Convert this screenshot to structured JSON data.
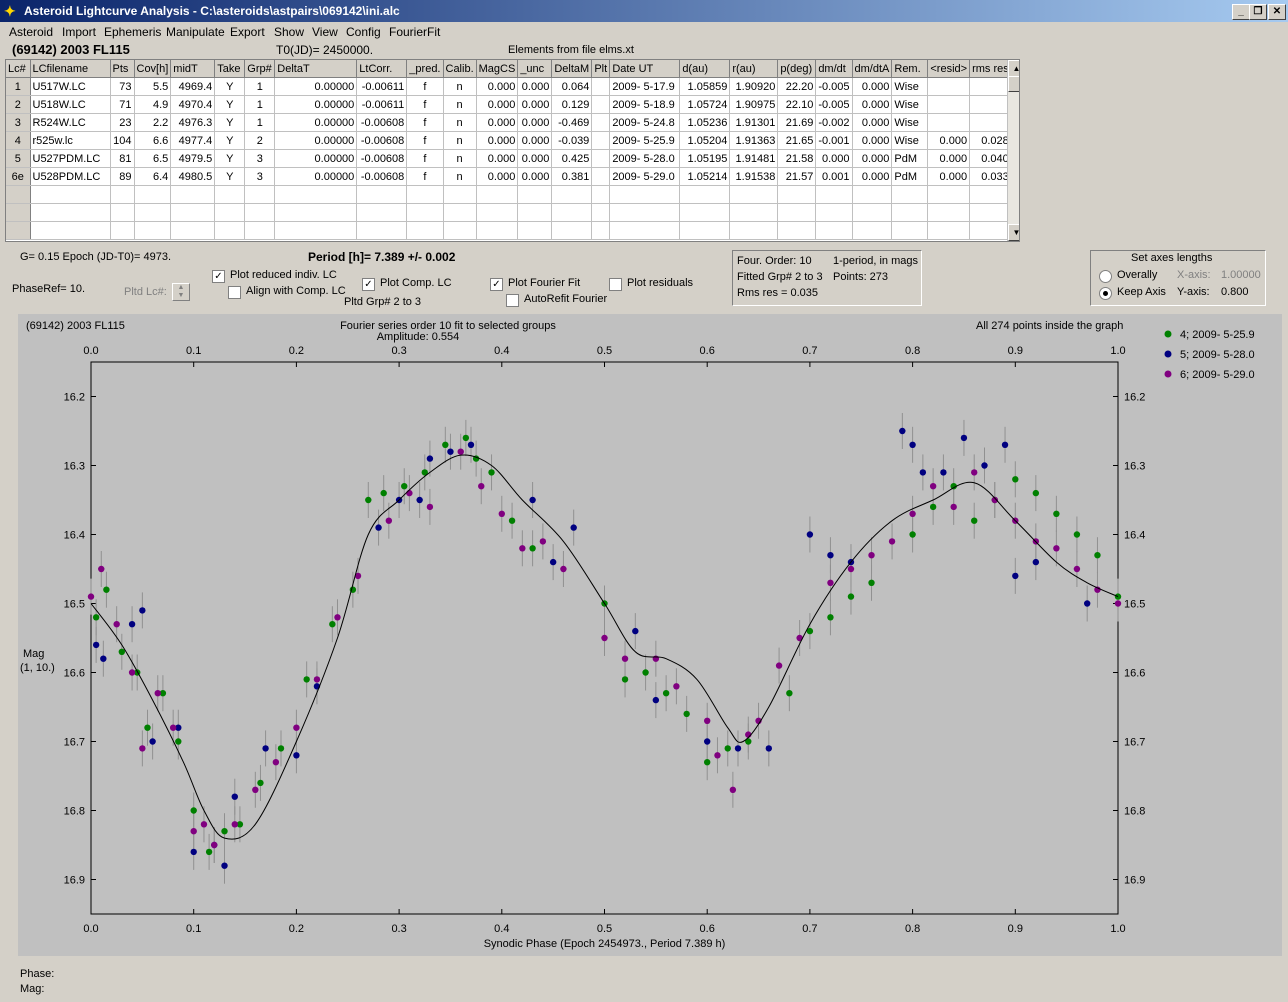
{
  "window": {
    "title": "Asteroid Lightcurve Analysis - C:\\asteroids\\astpairs\\069142\\ini.alc"
  },
  "menu": [
    "Asteroid",
    "Import",
    "Ephemeris",
    "Manipulate",
    "Export",
    "Show",
    "View",
    "Config",
    "FourierFit"
  ],
  "header": {
    "asteroid": "(69142) 2003 FL115",
    "t0": "T0(JD)= 2450000.",
    "elements": "Elements from file elms.xt"
  },
  "table": {
    "columns": [
      "Lc#",
      "LCfilename",
      "Pts",
      "Cov[h]",
      "midT",
      "Take",
      "Grp#",
      "DeltaT",
      "LtCorr.",
      "_pred.",
      "Calib.",
      "MagCS",
      "_unc",
      "DeltaM",
      "Plt",
      "Date UT",
      "d(au)",
      "r(au)",
      "p(deg)",
      "dm/dt",
      "dm/dtA",
      "Rem.",
      "<resid>",
      "rms res"
    ],
    "rows": [
      [
        "1",
        "U517W.LC",
        "73",
        "5.5",
        "4969.4",
        "Y",
        "1",
        "0.00000",
        "-0.00611",
        "f",
        "n",
        "0.000",
        "0.000",
        "0.064",
        "",
        "2009- 5-17.9",
        "1.05859",
        "1.90920",
        "22.20",
        "-0.005",
        "0.000",
        "Wise",
        "",
        ""
      ],
      [
        "2",
        "U518W.LC",
        "71",
        "4.9",
        "4970.4",
        "Y",
        "1",
        "0.00000",
        "-0.00611",
        "f",
        "n",
        "0.000",
        "0.000",
        "0.129",
        "",
        "2009- 5-18.9",
        "1.05724",
        "1.90975",
        "22.10",
        "-0.005",
        "0.000",
        "Wise",
        "",
        ""
      ],
      [
        "3",
        "R524W.LC",
        "23",
        "2.2",
        "4976.3",
        "Y",
        "1",
        "0.00000",
        "-0.00608",
        "f",
        "n",
        "0.000",
        "0.000",
        "-0.469",
        "",
        "2009- 5-24.8",
        "1.05236",
        "1.91301",
        "21.69",
        "-0.002",
        "0.000",
        "Wise",
        "",
        ""
      ],
      [
        "4",
        "r525w.lc",
        "104",
        "6.6",
        "4977.4",
        "Y",
        "2",
        "0.00000",
        "-0.00608",
        "f",
        "n",
        "0.000",
        "0.000",
        "-0.039",
        "",
        "2009- 5-25.9",
        "1.05204",
        "1.91363",
        "21.65",
        "-0.001",
        "0.000",
        "Wise",
        "0.000",
        "0.028"
      ],
      [
        "5",
        "U527PDM.LC",
        "81",
        "6.5",
        "4979.5",
        "Y",
        "3",
        "0.00000",
        "-0.00608",
        "f",
        "n",
        "0.000",
        "0.000",
        "0.425",
        "",
        "2009- 5-28.0",
        "1.05195",
        "1.91481",
        "21.58",
        "0.000",
        "0.000",
        "PdM",
        "0.000",
        "0.040"
      ],
      [
        "6e",
        "U528PDM.LC",
        "89",
        "6.4",
        "4980.5",
        "Y",
        "3",
        "0.00000",
        "-0.00608",
        "f",
        "n",
        "0.000",
        "0.000",
        "0.381",
        "",
        "2009- 5-29.0",
        "1.05214",
        "1.91538",
        "21.57",
        "0.001",
        "0.000",
        "PdM",
        "0.000",
        "0.033"
      ]
    ],
    "empty_rows": 3
  },
  "controls": {
    "g_epoch": "G= 0.15   Epoch (JD-T0)= 4973.",
    "period": "Period [h]= 7.389 +/- 0.002",
    "phaseref": "PhaseRef= 10.",
    "pltd_lc": "Pltd Lc#:",
    "plot_reduced": "Plot reduced indiv. LC",
    "align": "Align with Comp. LC",
    "plot_comp": "Plot Comp. LC",
    "pltd_grp": "Pltd Grp#  2   to   3",
    "plot_fourier": "Plot Fourier Fit",
    "autorefit": "AutoRefit Fourier",
    "plot_residuals": "Plot residuals",
    "checked": {
      "plot_reduced": true,
      "align": false,
      "plot_comp": true,
      "plot_fourier": true,
      "autorefit": false,
      "plot_residuals": false
    }
  },
  "fourier_box": {
    "order": "Four. Order: 10",
    "period_mode": "1-period, in mags",
    "fitted": "Fitted Grp# 2 to 3",
    "points": "Points: 273",
    "rms": "Rms res     = 0.035"
  },
  "axes_box": {
    "title": "Set axes lengths",
    "overally": "Overally",
    "keep": "Keep Axis",
    "xaxis_label": "X-axis:",
    "xaxis_val": "1.00000",
    "yaxis_label": "Y-axis:",
    "yaxis_val": "0.800",
    "selected": "keep"
  },
  "plot": {
    "top_left": "(69142) 2003 FL115",
    "top_center": "Fourier series order 10 fit to selected groups",
    "amplitude": "Amplitude: 0.554",
    "top_right": "All 274 points inside the graph",
    "ylabel1": "Mag",
    "ylabel2": "(1, 10.)",
    "xlabel": "Synodic Phase (Epoch 2454973., Period 7.389 h)"
  },
  "legend": [
    {
      "name": "4; 2009- 5-25.9",
      "color": "#008000"
    },
    {
      "name": "5; 2009- 5-28.0",
      "color": "#000080"
    },
    {
      "name": "6; 2009- 5-29.0",
      "color": "#800080"
    }
  ],
  "status": {
    "phase": "Phase:",
    "mag": "Mag:"
  },
  "chart_data": {
    "type": "scatter",
    "title": "Fourier series order 10 fit to selected groups",
    "xlabel": "Synodic Phase (Epoch 2454973., Period 7.389 h)",
    "ylabel": "Mag",
    "xlim": [
      0,
      1
    ],
    "ylim": [
      16.95,
      16.15
    ],
    "x_ticks": [
      "0.0",
      "0.1",
      "0.2",
      "0.3",
      "0.4",
      "0.5",
      "0.6",
      "0.7",
      "0.8",
      "0.9",
      "1.0"
    ],
    "y_ticks": [
      "16.2",
      "16.3",
      "16.4",
      "16.5",
      "16.6",
      "16.7",
      "16.8",
      "16.9"
    ],
    "fourier_fit": {
      "x": [
        0.0,
        0.03,
        0.06,
        0.09,
        0.11,
        0.13,
        0.16,
        0.2,
        0.24,
        0.27,
        0.3,
        0.33,
        0.36,
        0.39,
        0.42,
        0.46,
        0.5,
        0.53,
        0.56,
        0.59,
        0.62,
        0.635,
        0.66,
        0.7,
        0.74,
        0.78,
        0.82,
        0.86,
        0.9,
        0.94,
        0.97,
        1.0
      ],
      "y": [
        16.5,
        16.56,
        16.64,
        16.73,
        16.8,
        16.84,
        16.82,
        16.7,
        16.55,
        16.4,
        16.35,
        16.31,
        16.285,
        16.3,
        16.35,
        16.41,
        16.5,
        16.57,
        16.58,
        16.61,
        16.68,
        16.7,
        16.65,
        16.53,
        16.44,
        16.38,
        16.35,
        16.325,
        16.38,
        16.44,
        16.47,
        16.49
      ]
    },
    "series": [
      {
        "name": "4; 2009- 5-25.9",
        "color": "#008000",
        "x": [
          0.005,
          0.015,
          0.03,
          0.045,
          0.055,
          0.07,
          0.085,
          0.1,
          0.115,
          0.13,
          0.145,
          0.165,
          0.185,
          0.21,
          0.235,
          0.255,
          0.27,
          0.285,
          0.305,
          0.325,
          0.345,
          0.365,
          0.375,
          0.39,
          0.41,
          0.43,
          0.5,
          0.52,
          0.54,
          0.56,
          0.58,
          0.6,
          0.62,
          0.64,
          0.68,
          0.7,
          0.72,
          0.74,
          0.76,
          0.8,
          0.82,
          0.84,
          0.86,
          0.88,
          0.9,
          0.92,
          0.94,
          0.96,
          0.98,
          1.0
        ],
        "y": [
          16.52,
          16.48,
          16.57,
          16.6,
          16.68,
          16.63,
          16.7,
          16.8,
          16.86,
          16.83,
          16.82,
          16.76,
          16.71,
          16.61,
          16.53,
          16.48,
          16.35,
          16.34,
          16.33,
          16.31,
          16.27,
          16.26,
          16.29,
          16.31,
          16.38,
          16.42,
          16.5,
          16.61,
          16.6,
          16.63,
          16.66,
          16.73,
          16.71,
          16.7,
          16.63,
          16.54,
          16.52,
          16.49,
          16.47,
          16.4,
          16.36,
          16.33,
          16.38,
          16.35,
          16.32,
          16.34,
          16.37,
          16.4,
          16.43,
          16.49
        ]
      },
      {
        "name": "5; 2009- 5-28.0",
        "color": "#000080",
        "x": [
          0.005,
          0.012,
          0.04,
          0.05,
          0.06,
          0.085,
          0.1,
          0.12,
          0.13,
          0.14,
          0.17,
          0.2,
          0.22,
          0.28,
          0.3,
          0.32,
          0.33,
          0.35,
          0.37,
          0.43,
          0.45,
          0.47,
          0.53,
          0.55,
          0.6,
          0.63,
          0.66,
          0.7,
          0.72,
          0.74,
          0.79,
          0.8,
          0.81,
          0.83,
          0.85,
          0.87,
          0.89,
          0.9,
          0.92,
          0.97
        ],
        "y": [
          16.56,
          16.58,
          16.53,
          16.51,
          16.7,
          16.68,
          16.86,
          16.85,
          16.88,
          16.78,
          16.71,
          16.72,
          16.62,
          16.39,
          16.35,
          16.35,
          16.29,
          16.28,
          16.27,
          16.35,
          16.44,
          16.39,
          16.54,
          16.64,
          16.7,
          16.71,
          16.71,
          16.4,
          16.43,
          16.44,
          16.25,
          16.27,
          16.31,
          16.31,
          16.26,
          16.3,
          16.27,
          16.46,
          16.44,
          16.5
        ]
      },
      {
        "name": "6; 2009- 5-29.0",
        "color": "#800080",
        "x": [
          0.0,
          0.01,
          0.025,
          0.04,
          0.05,
          0.065,
          0.08,
          0.1,
          0.11,
          0.12,
          0.14,
          0.16,
          0.18,
          0.2,
          0.22,
          0.24,
          0.26,
          0.29,
          0.31,
          0.33,
          0.36,
          0.38,
          0.4,
          0.42,
          0.44,
          0.46,
          0.5,
          0.52,
          0.55,
          0.57,
          0.6,
          0.61,
          0.625,
          0.64,
          0.65,
          0.67,
          0.69,
          0.72,
          0.74,
          0.76,
          0.78,
          0.8,
          0.82,
          0.84,
          0.86,
          0.88,
          0.9,
          0.92,
          0.94,
          0.96,
          0.98,
          1.0
        ],
        "y": [
          16.49,
          16.45,
          16.53,
          16.6,
          16.71,
          16.63,
          16.68,
          16.83,
          16.82,
          16.85,
          16.82,
          16.77,
          16.73,
          16.68,
          16.61,
          16.52,
          16.46,
          16.38,
          16.34,
          16.36,
          16.28,
          16.33,
          16.37,
          16.42,
          16.41,
          16.45,
          16.55,
          16.58,
          16.58,
          16.62,
          16.67,
          16.72,
          16.77,
          16.69,
          16.67,
          16.59,
          16.55,
          16.47,
          16.45,
          16.43,
          16.41,
          16.37,
          16.33,
          16.36,
          16.31,
          16.35,
          16.38,
          16.41,
          16.42,
          16.45,
          16.48,
          16.5
        ]
      }
    ]
  }
}
